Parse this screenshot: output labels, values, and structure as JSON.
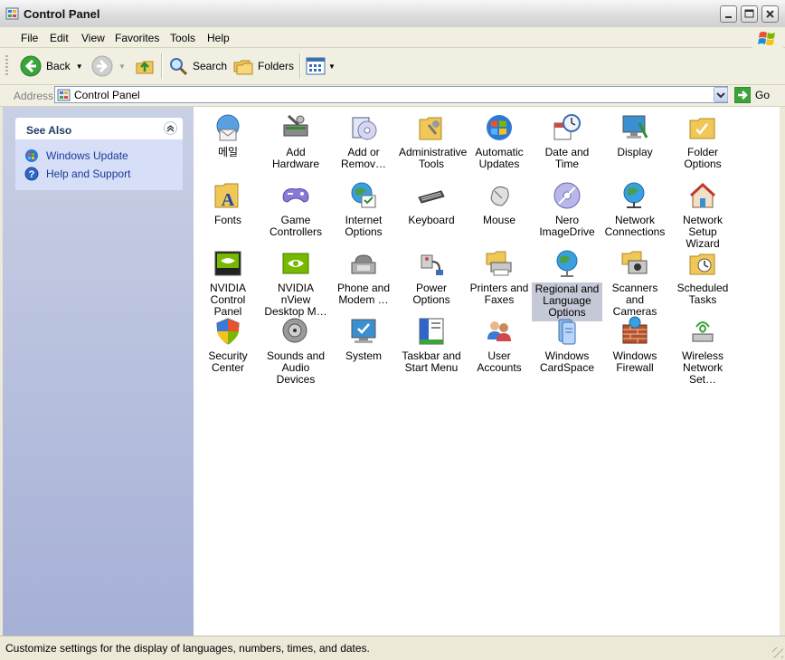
{
  "window": {
    "title": "Control Panel",
    "title_icon": "control-panel-icon"
  },
  "menu": [
    "File",
    "Edit",
    "View",
    "Favorites",
    "Tools",
    "Help"
  ],
  "toolbar": {
    "back_label": "Back",
    "search_label": "Search",
    "folders_label": "Folders"
  },
  "address": {
    "label": "Address",
    "value": "Control Panel",
    "go_label": "Go"
  },
  "see_also": {
    "title": "See Also",
    "links": [
      {
        "label": "Windows Update",
        "icon": "windows-update-icon"
      },
      {
        "label": "Help and Support",
        "icon": "help-icon"
      }
    ]
  },
  "items": [
    {
      "label": "메일",
      "icon": "mail-icon"
    },
    {
      "label": "Add Hardware",
      "icon": "add-hardware-icon"
    },
    {
      "label": "Add or Remov…",
      "icon": "add-remove-programs-icon"
    },
    {
      "label": "Administrative Tools",
      "icon": "administrative-tools-icon"
    },
    {
      "label": "Automatic Updates",
      "icon": "automatic-updates-icon"
    },
    {
      "label": "Date and Time",
      "icon": "date-time-icon"
    },
    {
      "label": "Display",
      "icon": "display-icon"
    },
    {
      "label": "Folder Options",
      "icon": "folder-options-icon"
    },
    {
      "label": "Fonts",
      "icon": "fonts-icon"
    },
    {
      "label": "Game Controllers",
      "icon": "game-controllers-icon"
    },
    {
      "label": "Internet Options",
      "icon": "internet-options-icon"
    },
    {
      "label": "Keyboard",
      "icon": "keyboard-icon"
    },
    {
      "label": "Mouse",
      "icon": "mouse-icon"
    },
    {
      "label": "Nero ImageDrive",
      "icon": "nero-imagedrive-icon"
    },
    {
      "label": "Network Connections",
      "icon": "network-connections-icon"
    },
    {
      "label": "Network Setup Wizard",
      "icon": "network-setup-wizard-icon"
    },
    {
      "label": "NVIDIA Control Panel",
      "icon": "nvidia-control-panel-icon"
    },
    {
      "label": "NVIDIA nView Desktop M…",
      "icon": "nvidia-nview-icon"
    },
    {
      "label": "Phone and Modem …",
      "icon": "phone-modem-icon"
    },
    {
      "label": "Power Options",
      "icon": "power-options-icon"
    },
    {
      "label": "Printers and Faxes",
      "icon": "printers-faxes-icon"
    },
    {
      "label": "Regional and Language Options",
      "icon": "regional-language-icon",
      "selected": true
    },
    {
      "label": "Scanners and Cameras",
      "icon": "scanners-cameras-icon"
    },
    {
      "label": "Scheduled Tasks",
      "icon": "scheduled-tasks-icon"
    },
    {
      "label": "Security Center",
      "icon": "security-center-icon"
    },
    {
      "label": "Sounds and Audio Devices",
      "icon": "sounds-audio-icon"
    },
    {
      "label": "System",
      "icon": "system-icon"
    },
    {
      "label": "Taskbar and Start Menu",
      "icon": "taskbar-start-menu-icon"
    },
    {
      "label": "User Accounts",
      "icon": "user-accounts-icon"
    },
    {
      "label": "Windows CardSpace",
      "icon": "windows-cardspace-icon"
    },
    {
      "label": "Windows Firewall",
      "icon": "windows-firewall-icon"
    },
    {
      "label": "Wireless Network Set…",
      "icon": "wireless-network-icon"
    }
  ],
  "status": "Customize settings for the display of languages, numbers, times, and dates."
}
